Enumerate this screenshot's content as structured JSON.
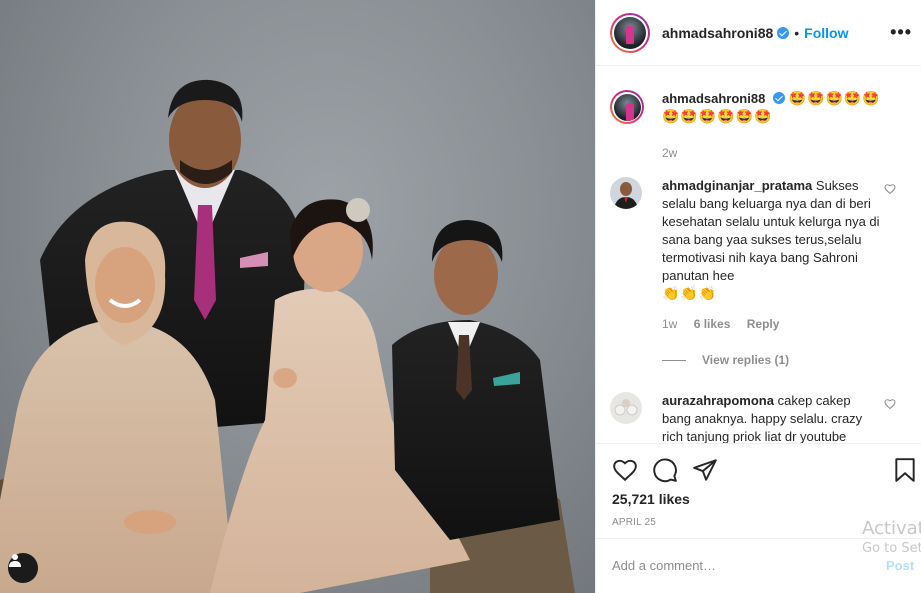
{
  "post": {
    "username": "ahmadsahroni88",
    "follow_label": "Follow",
    "separator": "•",
    "more_label": "•••"
  },
  "caption": {
    "username": "ahmadsahroni88",
    "text": "🤩🤩🤩🤩🤩🤩🤩🤩🤩🤩🤩",
    "time": "2w"
  },
  "comments": [
    {
      "username": "ahmadginanjar_pratama",
      "text": "Sukses selalu bang keluarga nya dan di beri kesehatan selalu untuk kelurga nya di sana bang yaa sukses terus,selalu termotivasi nih kaya bang Sahroni panutan hee",
      "emoji": "👏👏👏",
      "time": "1w",
      "likes": "6 likes",
      "reply_label": "Reply",
      "view_replies": "View replies (1)"
    },
    {
      "username": "aurazahrapomona",
      "text": "cakep cakep bang anaknya. happy selalu. crazy rich tanjung priok liat dr youtube"
    }
  ],
  "stats": {
    "likes": "25,721 likes",
    "date": "APRIL 25"
  },
  "add_comment": {
    "placeholder": "Add a comment…",
    "post_label": "Post"
  },
  "watermark": {
    "line1": "Activat",
    "line2": "Go to Set"
  },
  "icons": [
    "heart-icon",
    "comment-icon",
    "share-icon",
    "bookmark-icon",
    "user-tag-icon",
    "more-icon",
    "verified-icon"
  ],
  "colors": {
    "accent": "#0095f6",
    "verified": "#3897f0",
    "muted": "#8e8e8e",
    "post_disabled": "#b2dffc"
  }
}
